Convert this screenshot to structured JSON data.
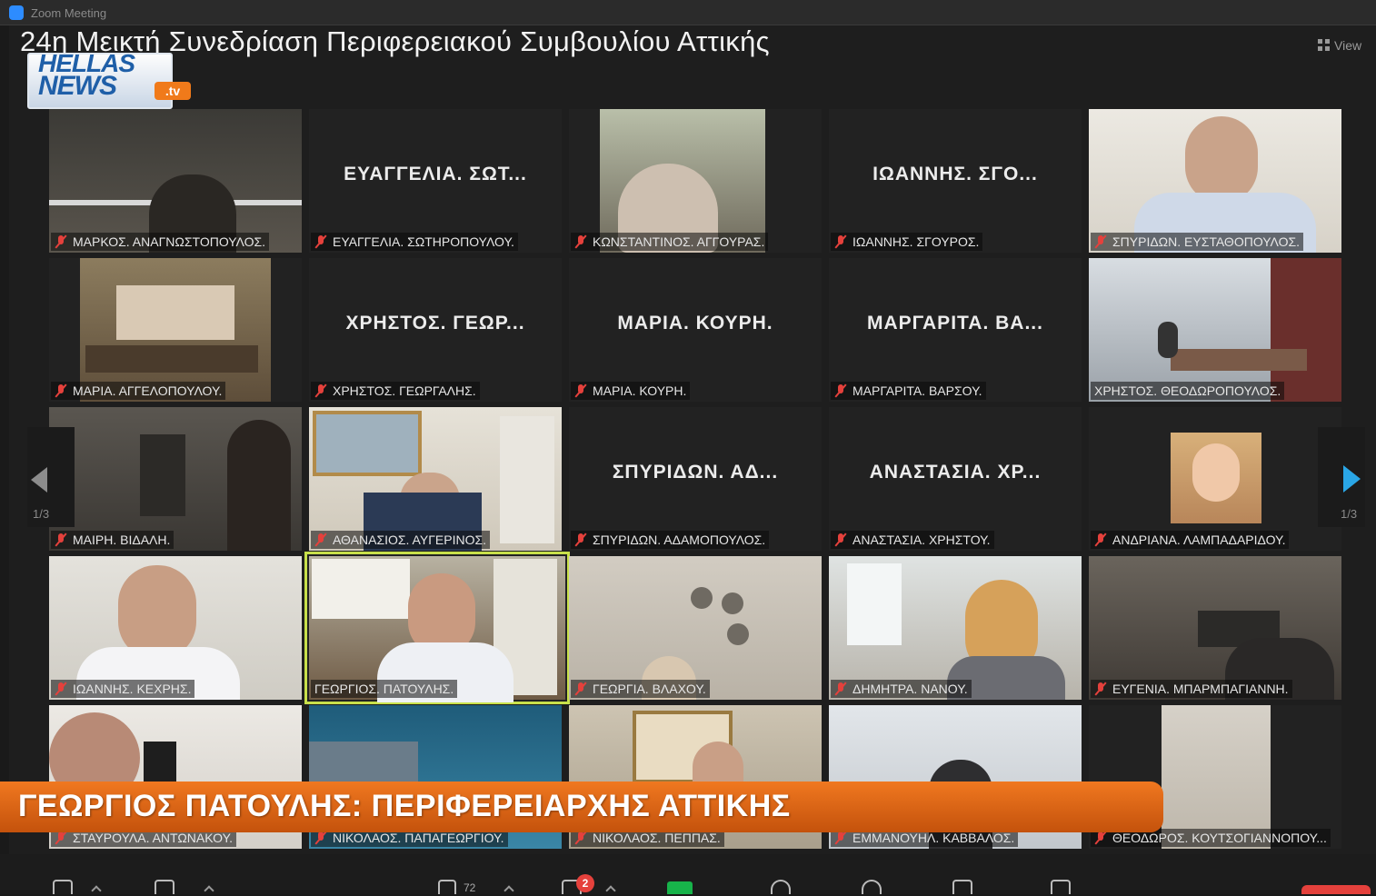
{
  "window": {
    "app_title": "Zoom Meeting"
  },
  "meeting": {
    "title": "24η Μεικτή Συνεδρίαση Περιφερειακού Συμβουλίου Αττικής",
    "view_label": "View"
  },
  "logo": {
    "line1": "HELLAS",
    "line2": "NEWS",
    "suffix": ".tv"
  },
  "pager": {
    "left_label": "1/3",
    "right_label": "1/3"
  },
  "tiles": [
    {
      "name": "ΜΑΡΚΟΣ. ΑΝΑΓΝΩΣΤΟΠΟΥΛΟΣ.",
      "big": "",
      "muted": true
    },
    {
      "name": "ΕΥΑΓΓΕΛΙΑ. ΣΩΤΗΡΟΠΟΥΛΟΥ.",
      "big": "ΕΥΑΓΓΕΛΙΑ. ΣΩΤ...",
      "muted": true
    },
    {
      "name": "ΚΩΝΣΤΑΝΤΙΝΟΣ. ΑΓΓΟΥΡΑΣ.",
      "big": "",
      "muted": true
    },
    {
      "name": "ΙΩΑΝΝΗΣ. ΣΓΟΥΡΟΣ.",
      "big": "ΙΩΑΝΝΗΣ. ΣΓΟ...",
      "muted": true
    },
    {
      "name": "ΣΠΥΡΙΔΩΝ. ΕΥΣΤΑΘΟΠΟΥΛΟΣ.",
      "big": "",
      "muted": true
    },
    {
      "name": "ΜΑΡΙΑ. ΑΓΓΕΛΟΠΟΥΛΟΥ.",
      "big": "",
      "muted": true
    },
    {
      "name": "ΧΡΗΣΤΟΣ. ΓΕΩΡΓΑΛΗΣ.",
      "big": "ΧΡΗΣΤΟΣ. ΓΕΩΡ...",
      "muted": true
    },
    {
      "name": "ΜΑΡΙΑ. ΚΟΥΡΗ.",
      "big": "ΜΑΡΙΑ. ΚΟΥΡΗ.",
      "muted": true
    },
    {
      "name": "ΜΑΡΓΑΡΙΤΑ. ΒΑΡΣΟΥ.",
      "big": "ΜΑΡΓΑΡΙΤΑ. ΒΑ...",
      "muted": true
    },
    {
      "name": "ΧΡΗΣΤΟΣ. ΘΕΟΔΩΡΟΠΟΥΛΟΣ.",
      "big": "",
      "muted": false
    },
    {
      "name": "ΜΑΙΡΗ. ΒΙΔΑΛΗ.",
      "big": "",
      "muted": true
    },
    {
      "name": "ΑΘΑΝΑΣΙΟΣ. ΑΥΓΕΡΙΝΟΣ.",
      "big": "",
      "muted": true
    },
    {
      "name": "ΣΠΥΡΙΔΩΝ. ΑΔΑΜΟΠΟΥΛΟΣ.",
      "big": "ΣΠΥΡΙΔΩΝ. ΑΔ...",
      "muted": true
    },
    {
      "name": "ΑΝΑΣΤΑΣΙΑ. ΧΡΗΣΤΟΥ.",
      "big": "ΑΝΑΣΤΑΣΙΑ. ΧΡ...",
      "muted": true
    },
    {
      "name": "ΑΝΔΡΙΑΝΑ. ΛΑΜΠΑΔΑΡΙΔΟΥ.",
      "big": "",
      "muted": true
    },
    {
      "name": "ΙΩΑΝΝΗΣ. ΚΕΧΡΗΣ.",
      "big": "",
      "muted": true
    },
    {
      "name": "ΓΕΩΡΓΙΟΣ. ΠΑΤΟΥΛΗΣ.",
      "big": "",
      "muted": false
    },
    {
      "name": "ΓΕΩΡΓΙΑ. ΒΛΑΧΟΥ.",
      "big": "",
      "muted": true
    },
    {
      "name": "ΔΗΜΗΤΡΑ. ΝΑΝΟΥ.",
      "big": "",
      "muted": true
    },
    {
      "name": "ΕΥΓΕΝΙΑ. ΜΠΑΡΜΠΑΓΙΑΝΝΗ.",
      "big": "",
      "muted": true
    },
    {
      "name": "ΣΤΑΥΡΟΥΛΑ. ΑΝΤΩΝΑΚΟΥ.",
      "big": "",
      "muted": true
    },
    {
      "name": "ΝΙΚΟΛΑΟΣ. ΠΑΠΑΓΕΩΡΓΙΟΥ.",
      "big": "",
      "muted": true
    },
    {
      "name": "ΝΙΚΟΛΑΟΣ. ΠΕΠΠΑΣ.",
      "big": "",
      "muted": true
    },
    {
      "name": "ΕΜΜΑΝΟΥΗΛ. ΚΑΒΒΑΛΟΣ.",
      "big": "",
      "muted": true
    },
    {
      "name": "ΘΕΟΔΩΡΟΣ. ΚΟΥΤΣΟΓΙΑΝΝΟΠΟΥ...",
      "big": "",
      "muted": true
    }
  ],
  "banner": {
    "text": "ΓΕΩΡΓΙΟΣ ΠΑΤΟΥΛΗΣ: ΠΕΡΙΦΕΡΕΙΑΡΧΗΣ ΑΤΤΙΚΗΣ"
  },
  "toolbar": {
    "participants_count": "72",
    "chat_badge": "2"
  },
  "colors": {
    "active_speaker": "#c8e04a",
    "banner": "#e8701c",
    "muted_icon": "#e5413c",
    "pager_arrow": "#2aa6e6"
  }
}
